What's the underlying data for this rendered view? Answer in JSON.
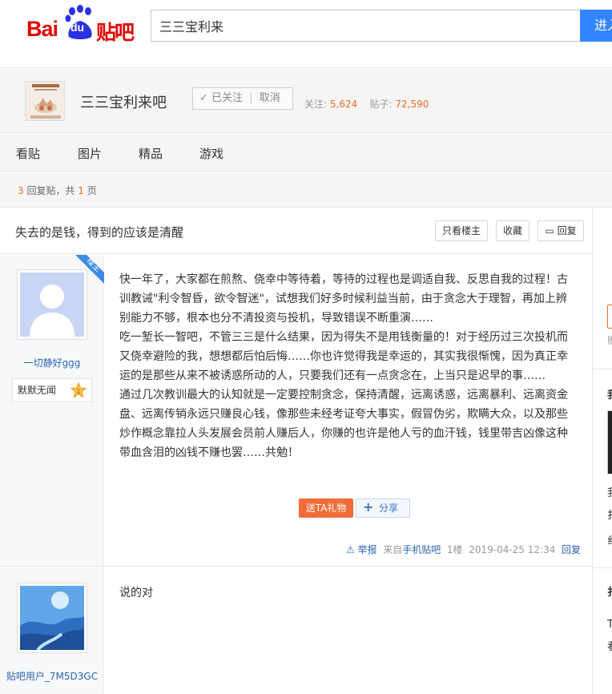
{
  "header": {
    "logo_bai": "Bai",
    "logo_du": "du",
    "logo_tieba": "贴吧",
    "search_value": "三三宝利来",
    "search_button": "进入"
  },
  "forum": {
    "name": "三三宝利来吧",
    "follow_label": "已关注",
    "follow_sep": "|",
    "cancel_label": "取消",
    "follow_count_label": "关注:",
    "follow_count": "5,624",
    "post_count_label": "贴子:",
    "post_count": "72,590"
  },
  "nav": {
    "tabs": [
      "看贴",
      "图片",
      "精品",
      "游戏"
    ]
  },
  "reply_bar": {
    "count": "3",
    "count_label": "回复贴，共",
    "pages": "1",
    "pages_label": "页"
  },
  "thread": {
    "title": "失去的是钱，得到的应该是清醒",
    "only_lz": "只看楼主",
    "collect": "收藏",
    "reply": "回复"
  },
  "posts": [
    {
      "author": "一切静好ggg",
      "level": "默默无闻",
      "badge": "楼主",
      "paragraphs": [
        "快一年了，大家都在煎熬、侥幸中等待着，等待的过程也是调适自我、反思自我的过程！古训教诫\"利令智昏，欲令智迷\"，试想我们好多时候利益当前，由于贪念大于理智，再加上辨别能力不够，根本也分不清投资与投机，导致错误不断重演……",
        "吃一堑长一智吧，不管三三是什么结果，因为得失不是用钱衡量的！对于经历过三次投机而又侥幸避险的我，想想都后怕后悔……你也许觉得我是幸运的，其实我很惭愧，因为真正幸运的是那些从来不被诱惑所动的人，只要我们还有一点贪念在，上当只是迟早的事……",
        "通过几次教训最大的认知就是一定要控制贪念，保持清醒，远离诱惑，远离暴利、远离资金盘、远离传销永远只赚良心钱，像那些未经考证夸大事实，假冒伪劣，欺瞒大众，以及那些炒作概念靠拉人头发展会员前人赚后人，你赚的也许是他人亏的血汗钱，钱里带吉凶像这种带血含泪的凶钱不赚也罢……共勉！"
      ],
      "gift": "送TA礼物",
      "share": "分享",
      "report": "举报",
      "source_prefix": "来自",
      "source": "手机贴吧",
      "floor": "1楼",
      "time": "2019-04-25 12:34",
      "reply": "回复"
    },
    {
      "author": "贴吧用户_7M5D3GC",
      "paragraphs": [
        "说的对"
      ]
    }
  ],
  "right_col": {
    "lines": [
      "赠",
      "我",
      "我",
      "扌",
      "纟",
      "扌",
      "T",
      "看"
    ]
  },
  "colors": {
    "brand_red": "#e10602",
    "brand_blue": "#3385ff",
    "accent_orange": "#f06a23",
    "link_blue": "#2d64b3"
  }
}
